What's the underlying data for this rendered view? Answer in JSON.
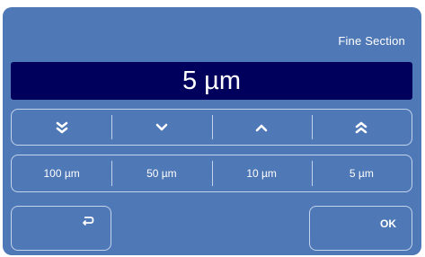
{
  "dialog": {
    "title": "Fine Section",
    "display_value": "5 µm"
  },
  "arrows": [
    {
      "icon": "double-chevron-down-icon"
    },
    {
      "icon": "chevron-down-icon"
    },
    {
      "icon": "chevron-up-icon"
    },
    {
      "icon": "double-chevron-up-icon"
    }
  ],
  "steps": [
    "100 µm",
    "50 µm",
    "10 µm",
    "5 µm"
  ],
  "buttons": {
    "back_icon": "return-icon",
    "ok_label": "OK"
  },
  "colors": {
    "panel": "#4f78b6",
    "display": "#00005c",
    "text": "#ffffff",
    "border": "#c5d3ec"
  }
}
